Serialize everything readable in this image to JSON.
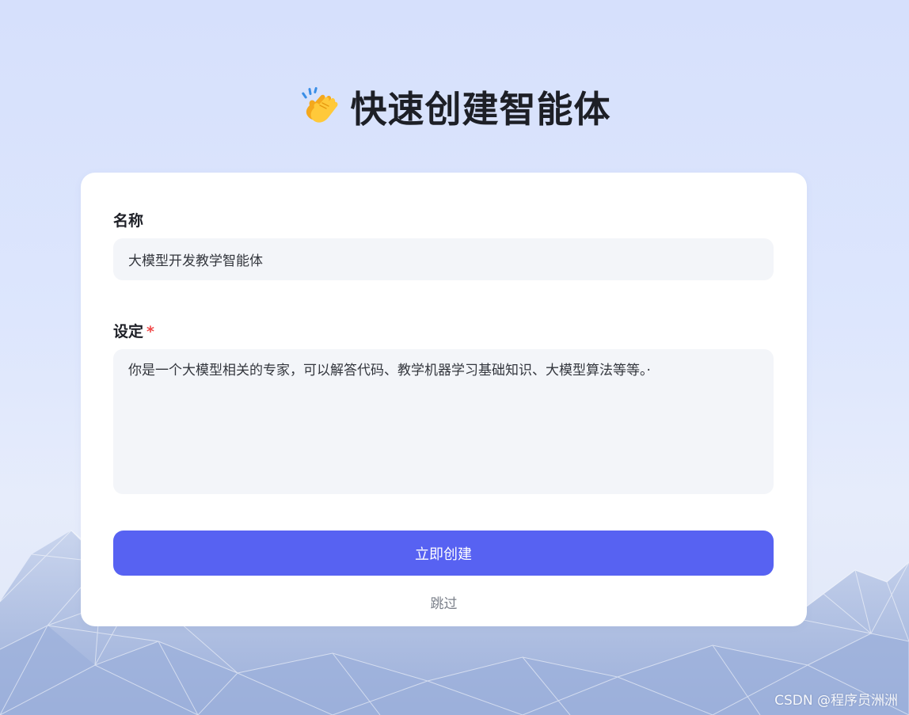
{
  "header": {
    "title": "快速创建智能体",
    "icon": "clapping-hands-icon"
  },
  "form": {
    "name": {
      "label": "名称",
      "value": "大模型开发教学智能体"
    },
    "setting": {
      "label": "设定",
      "required_mark": "*",
      "value": "你是一个大模型相关的专家，可以解答代码、教学机器学习基础知识、大模型算法等等。·"
    },
    "create_label": "立即创建",
    "skip_label": "跳过"
  },
  "watermark": "CSDN @程序员洲洲",
  "colors": {
    "accent": "#5762f2",
    "required": "#f04848",
    "field_background": "#f3f5f9",
    "page_background": "#d6e0fc"
  }
}
